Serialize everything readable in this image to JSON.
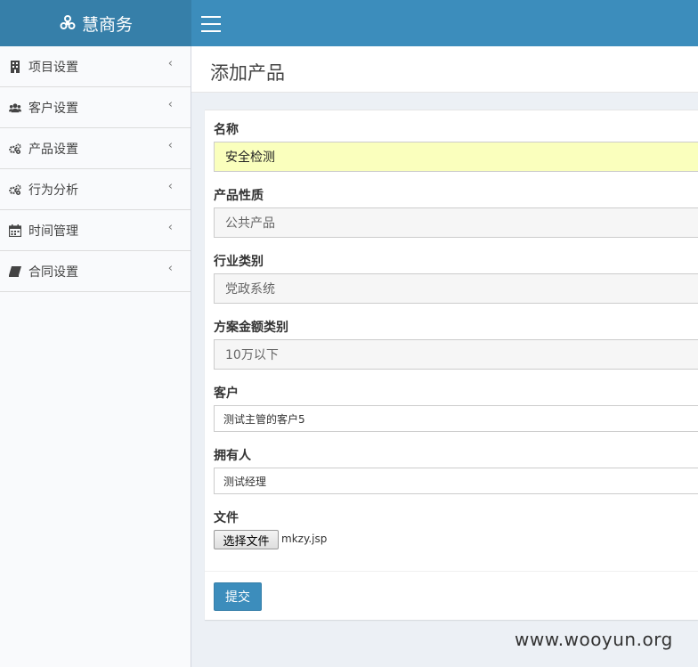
{
  "app": {
    "title": "慧商务",
    "logo_icon": "biohazard-icon"
  },
  "sidebar": {
    "items": [
      {
        "label": "项目设置",
        "icon": "building-icon"
      },
      {
        "label": "客户设置",
        "icon": "users-icon"
      },
      {
        "label": "产品设置",
        "icon": "gears-icon"
      },
      {
        "label": "行为分析",
        "icon": "gears-icon"
      },
      {
        "label": "时间管理",
        "icon": "calendar-icon"
      },
      {
        "label": "合同设置",
        "icon": "book-icon"
      }
    ],
    "chevron": "‹"
  },
  "page": {
    "title": "添加产品"
  },
  "form": {
    "name": {
      "label": "名称",
      "value": "安全检测"
    },
    "nature": {
      "label": "产品性质",
      "value": "公共产品"
    },
    "industry": {
      "label": "行业类别",
      "value": "党政系统"
    },
    "amount": {
      "label": "方案金额类别",
      "value": "10万以下"
    },
    "client": {
      "label": "客户",
      "value": "测试主管的客户5"
    },
    "owner": {
      "label": "拥有人",
      "value": "测试经理"
    },
    "file": {
      "label": "文件",
      "button": "选择文件",
      "filename": "mkzy.jsp"
    },
    "submit": "提交"
  },
  "watermark": "www.wooyun.org",
  "colors": {
    "header": "#3c8dbc",
    "logo_bg": "#367fa9",
    "autofill": "#faffbd"
  }
}
